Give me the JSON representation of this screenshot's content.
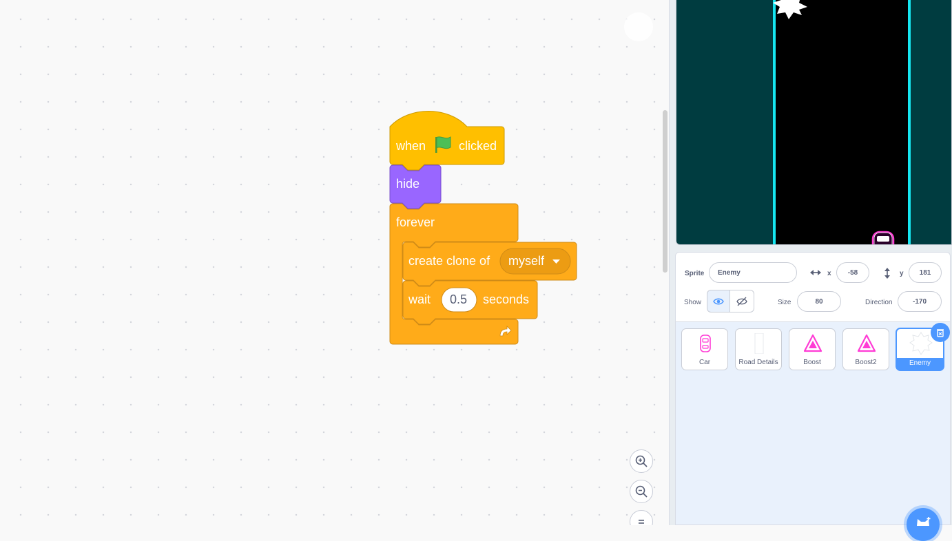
{
  "colors": {
    "events": "#ffbf00",
    "looks": "#9966ff",
    "control": "#ffab19",
    "control_dark": "#cf8b17",
    "dropdown": "#ec9c13",
    "stage_bg": "#003c40",
    "neon_cyan": "#15e6f1",
    "neon_pink": "#ff3bd5",
    "selected_blue": "#4c97ff"
  },
  "script": {
    "hat": {
      "when": "when",
      "icon": "green-flag-icon",
      "clicked": "clicked"
    },
    "hide": {
      "label": "hide"
    },
    "forever": {
      "label": "forever",
      "icon": "loop-arrow-icon"
    },
    "create_clone": {
      "label": "create clone of",
      "target": "myself",
      "icon": "dropdown-arrow-icon"
    },
    "wait": {
      "label": "wait",
      "value": "0.5",
      "unit": "seconds"
    }
  },
  "zoom_controls": [
    "zoom-in-icon",
    "zoom-out-icon",
    "zoom-reset-icon"
  ],
  "sprite_info": {
    "sprite_label": "Sprite",
    "sprite_name": "Enemy",
    "x_label": "x",
    "x_value": "-58",
    "y_label": "y",
    "y_value": "181",
    "show_label": "Show",
    "size_label": "Size",
    "size_value": "80",
    "direction_label": "Direction",
    "direction_value": "-170",
    "visible": true
  },
  "sprites": [
    {
      "name": "Car",
      "icon": "car-icon",
      "selected": false
    },
    {
      "name": "Road Details",
      "icon": "road-details-icon",
      "selected": false
    },
    {
      "name": "Boost",
      "icon": "boost-triangle-icon",
      "selected": false
    },
    {
      "name": "Boost2",
      "icon": "boost-triangle-icon",
      "selected": false
    },
    {
      "name": "Enemy",
      "icon": "enemy-star-icon",
      "selected": true
    }
  ]
}
